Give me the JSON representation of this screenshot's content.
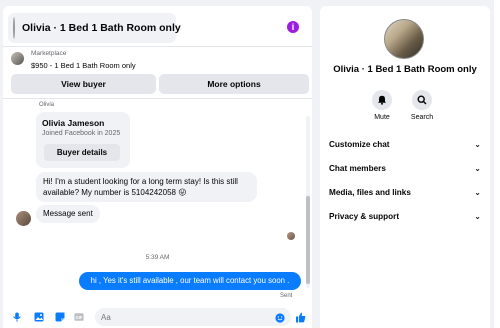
{
  "header": {
    "title": "Olivia · 1 Bed 1 Bath Room only"
  },
  "marketplace": {
    "label": "Marketplace",
    "listing": "$950 - 1 Bed 1 Bath Room only"
  },
  "actions": {
    "view_buyer": "View buyer",
    "more_options": "More options"
  },
  "conversation": {
    "sender_small": "Olivia",
    "card": {
      "name": "Olivia Jameson",
      "joined": "Joined Facebook in 2025",
      "button": "Buyer details"
    },
    "incoming_1": "Hi! I'm a student looking for a long term stay! Is this still available? My number is 5104242058 😛",
    "incoming_2": "Message sent",
    "timestamp": "5:39 AM",
    "outgoing": "hi , Yes it's still available , our team will contact you soon .",
    "status": "Sent"
  },
  "composer": {
    "placeholder": "Aa"
  },
  "sidebar": {
    "title": "Olivia · 1 Bed 1 Bath Room only",
    "mute_label": "Mute",
    "search_label": "Search",
    "rows": [
      {
        "label": "Customize chat"
      },
      {
        "label": "Chat members"
      },
      {
        "label": "Media, files and links"
      },
      {
        "label": "Privacy & support"
      }
    ]
  },
  "colors": {
    "accent": "#0a7cff",
    "info": "#9d1ee0",
    "bubble_in": "#f0f2f5"
  }
}
